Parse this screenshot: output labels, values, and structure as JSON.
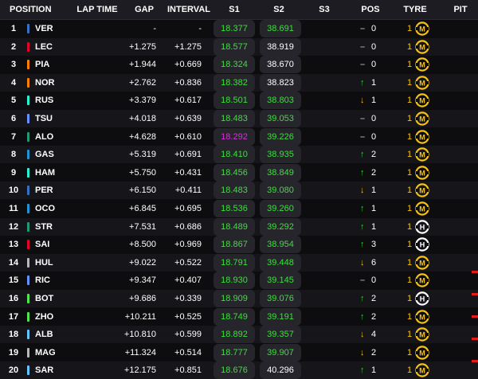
{
  "headers": {
    "position": "POSITION",
    "lap_time": "LAP TIME",
    "gap": "GAP",
    "interval": "INTERVAL",
    "s1": "S1",
    "s2": "S2",
    "s3": "S3",
    "pos": "POS",
    "tyre": "TYRE",
    "pit": "PIT"
  },
  "colors": {
    "sector_green": "#3be03b",
    "sector_purple": "#d633d6",
    "up": "#2fd52f",
    "down": "#f5c215",
    "medium_tyre": "#f5c215",
    "hard_tyre": "#ffffff"
  },
  "rows": [
    {
      "pos": "1",
      "code": "VER",
      "team_color": "#3671C6",
      "gap": "-",
      "interval": "-",
      "s1": "18.377",
      "s1_color": "green",
      "s2": "38.691",
      "s2_color": "green",
      "dir": "same",
      "pos_change": "0",
      "tyre_age": "1",
      "tyre": "M"
    },
    {
      "pos": "2",
      "code": "LEC",
      "team_color": "#E8002D",
      "gap": "+1.275",
      "interval": "+1.275",
      "s1": "18.577",
      "s1_color": "green",
      "s2": "38.919",
      "s2_color": "white",
      "dir": "same",
      "pos_change": "0",
      "tyre_age": "1",
      "tyre": "M"
    },
    {
      "pos": "3",
      "code": "PIA",
      "team_color": "#FF8000",
      "gap": "+1.944",
      "interval": "+0.669",
      "s1": "18.324",
      "s1_color": "green",
      "s2": "38.670",
      "s2_color": "white",
      "dir": "same",
      "pos_change": "0",
      "tyre_age": "1",
      "tyre": "M"
    },
    {
      "pos": "4",
      "code": "NOR",
      "team_color": "#FF8000",
      "gap": "+2.762",
      "interval": "+0.836",
      "s1": "18.382",
      "s1_color": "green",
      "s2": "38.823",
      "s2_color": "white",
      "dir": "up",
      "pos_change": "1",
      "tyre_age": "1",
      "tyre": "M"
    },
    {
      "pos": "5",
      "code": "RUS",
      "team_color": "#27F4D2",
      "gap": "+3.379",
      "interval": "+0.617",
      "s1": "18.501",
      "s1_color": "green",
      "s2": "38.803",
      "s2_color": "green",
      "dir": "down",
      "pos_change": "1",
      "tyre_age": "1",
      "tyre": "M"
    },
    {
      "pos": "6",
      "code": "TSU",
      "team_color": "#6692FF",
      "gap": "+4.018",
      "interval": "+0.639",
      "s1": "18.483",
      "s1_color": "green",
      "s2": "39.053",
      "s2_color": "green",
      "dir": "same",
      "pos_change": "0",
      "tyre_age": "1",
      "tyre": "M"
    },
    {
      "pos": "7",
      "code": "ALO",
      "team_color": "#229971",
      "gap": "+4.628",
      "interval": "+0.610",
      "s1": "18.292",
      "s1_color": "purple",
      "s2": "39.226",
      "s2_color": "green",
      "dir": "same",
      "pos_change": "0",
      "tyre_age": "1",
      "tyre": "M"
    },
    {
      "pos": "8",
      "code": "GAS",
      "team_color": "#2293D1",
      "gap": "+5.319",
      "interval": "+0.691",
      "s1": "18.410",
      "s1_color": "green",
      "s2": "38.935",
      "s2_color": "green",
      "dir": "up",
      "pos_change": "2",
      "tyre_age": "1",
      "tyre": "M"
    },
    {
      "pos": "9",
      "code": "HAM",
      "team_color": "#27F4D2",
      "gap": "+5.750",
      "interval": "+0.431",
      "s1": "18.456",
      "s1_color": "green",
      "s2": "38.849",
      "s2_color": "green",
      "dir": "up",
      "pos_change": "2",
      "tyre_age": "1",
      "tyre": "M"
    },
    {
      "pos": "10",
      "code": "PER",
      "team_color": "#3671C6",
      "gap": "+6.150",
      "interval": "+0.411",
      "s1": "18.483",
      "s1_color": "green",
      "s2": "39.080",
      "s2_color": "green",
      "dir": "down",
      "pos_change": "1",
      "tyre_age": "1",
      "tyre": "M"
    },
    {
      "pos": "11",
      "code": "OCO",
      "team_color": "#2293D1",
      "gap": "+6.845",
      "interval": "+0.695",
      "s1": "18.536",
      "s1_color": "green",
      "s2": "39.260",
      "s2_color": "green",
      "dir": "up",
      "pos_change": "1",
      "tyre_age": "1",
      "tyre": "M"
    },
    {
      "pos": "12",
      "code": "STR",
      "team_color": "#229971",
      "gap": "+7.531",
      "interval": "+0.686",
      "s1": "18.489",
      "s1_color": "green",
      "s2": "39.292",
      "s2_color": "green",
      "dir": "up",
      "pos_change": "1",
      "tyre_age": "1",
      "tyre": "H"
    },
    {
      "pos": "13",
      "code": "SAI",
      "team_color": "#E8002D",
      "gap": "+8.500",
      "interval": "+0.969",
      "s1": "18.867",
      "s1_color": "green",
      "s2": "38.954",
      "s2_color": "green",
      "dir": "up",
      "pos_change": "3",
      "tyre_age": "1",
      "tyre": "H"
    },
    {
      "pos": "14",
      "code": "HUL",
      "team_color": "#B6BABD",
      "gap": "+9.022",
      "interval": "+0.522",
      "s1": "18.791",
      "s1_color": "green",
      "s2": "39.448",
      "s2_color": "green",
      "dir": "down",
      "pos_change": "6",
      "tyre_age": "1",
      "tyre": "M"
    },
    {
      "pos": "15",
      "code": "RIC",
      "team_color": "#6692FF",
      "gap": "+9.347",
      "interval": "+0.407",
      "s1": "18.930",
      "s1_color": "green",
      "s2": "39.145",
      "s2_color": "green",
      "dir": "same",
      "pos_change": "0",
      "tyre_age": "1",
      "tyre": "M"
    },
    {
      "pos": "16",
      "code": "BOT",
      "team_color": "#52E252",
      "gap": "+9.686",
      "interval": "+0.339",
      "s1": "18.909",
      "s1_color": "green",
      "s2": "39.076",
      "s2_color": "green",
      "dir": "up",
      "pos_change": "2",
      "tyre_age": "1",
      "tyre": "H"
    },
    {
      "pos": "17",
      "code": "ZHO",
      "team_color": "#52E252",
      "gap": "+10.211",
      "interval": "+0.525",
      "s1": "18.749",
      "s1_color": "green",
      "s2": "39.191",
      "s2_color": "green",
      "dir": "up",
      "pos_change": "2",
      "tyre_age": "1",
      "tyre": "M"
    },
    {
      "pos": "18",
      "code": "ALB",
      "team_color": "#64C4FF",
      "gap": "+10.810",
      "interval": "+0.599",
      "s1": "18.892",
      "s1_color": "green",
      "s2": "39.357",
      "s2_color": "green",
      "dir": "down",
      "pos_change": "4",
      "tyre_age": "1",
      "tyre": "M"
    },
    {
      "pos": "19",
      "code": "MAG",
      "team_color": "#B6BABD",
      "gap": "+11.324",
      "interval": "+0.514",
      "s1": "18.777",
      "s1_color": "green",
      "s2": "39.907",
      "s2_color": "green",
      "dir": "down",
      "pos_change": "2",
      "tyre_age": "1",
      "tyre": "M"
    },
    {
      "pos": "20",
      "code": "SAR",
      "team_color": "#64C4FF",
      "gap": "+12.175",
      "interval": "+0.851",
      "s1": "18.676",
      "s1_color": "green",
      "s2": "40.296",
      "s2_color": "white",
      "dir": "up",
      "pos_change": "1",
      "tyre_age": "1",
      "tyre": "M"
    }
  ]
}
